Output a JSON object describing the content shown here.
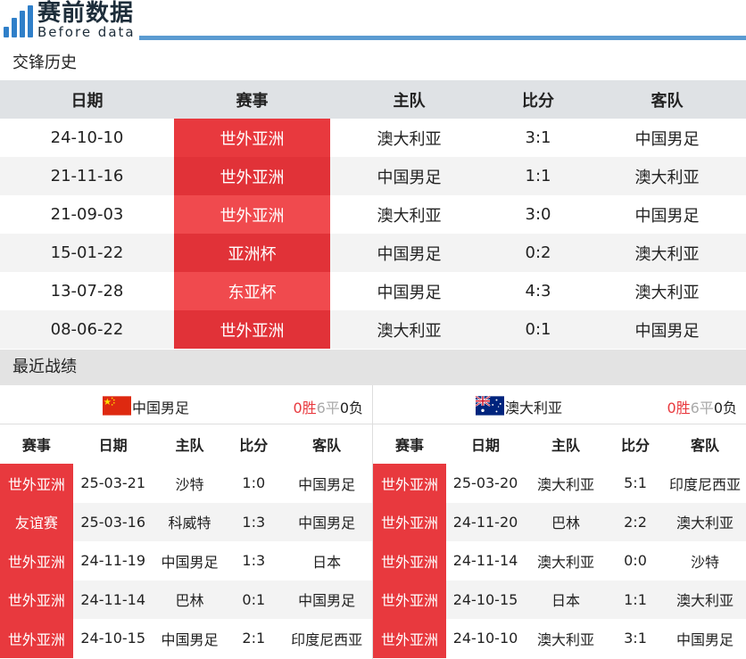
{
  "header": {
    "logo_title": "赛前数据",
    "logo_subtitle": "Before data"
  },
  "h2h": {
    "section_title": "交锋历史",
    "columns": [
      "日期",
      "赛事",
      "主队",
      "比分",
      "客队"
    ],
    "rows": [
      {
        "date": "24-10-10",
        "event": "世外亚洲",
        "home": "澳大利亚",
        "score": "3:1",
        "away": "中国男足"
      },
      {
        "date": "21-11-16",
        "event": "世外亚洲",
        "home": "中国男足",
        "score": "1:1",
        "away": "澳大利亚"
      },
      {
        "date": "21-09-03",
        "event": "世外亚洲",
        "home": "澳大利亚",
        "score": "3:0",
        "away": "中国男足"
      },
      {
        "date": "15-01-22",
        "event": "亚洲杯",
        "home": "中国男足",
        "score": "0:2",
        "away": "澳大利亚"
      },
      {
        "date": "13-07-28",
        "event": "东亚杯",
        "home": "中国男足",
        "score": "4:3",
        "away": "澳大利亚"
      },
      {
        "date": "08-06-22",
        "event": "世外亚洲",
        "home": "澳大利亚",
        "score": "0:1",
        "away": "中国男足"
      }
    ]
  },
  "recent": {
    "section_title": "最近战绩",
    "columns": [
      "赛事",
      "日期",
      "主队",
      "比分",
      "客队"
    ],
    "left": {
      "team": "中国男足",
      "wins": "0胜",
      "draws": "6平",
      "losses": "0负",
      "rows": [
        {
          "event": "世外亚洲",
          "date": "25-03-21",
          "home": "沙特",
          "score": "1:0",
          "away": "中国男足"
        },
        {
          "event": "友谊赛",
          "date": "25-03-16",
          "home": "科威特",
          "score": "1:3",
          "away": "中国男足"
        },
        {
          "event": "世外亚洲",
          "date": "24-11-19",
          "home": "中国男足",
          "score": "1:3",
          "away": "日本"
        },
        {
          "event": "世外亚洲",
          "date": "24-11-14",
          "home": "巴林",
          "score": "0:1",
          "away": "中国男足"
        },
        {
          "event": "世外亚洲",
          "date": "24-10-15",
          "home": "中国男足",
          "score": "2:1",
          "away": "印度尼西亚"
        }
      ]
    },
    "right": {
      "team": "澳大利亚",
      "wins": "0胜",
      "draws": "6平",
      "losses": "0负",
      "rows": [
        {
          "event": "世外亚洲",
          "date": "25-03-20",
          "home": "澳大利亚",
          "score": "5:1",
          "away": "印度尼西亚"
        },
        {
          "event": "世外亚洲",
          "date": "24-11-20",
          "home": "巴林",
          "score": "2:2",
          "away": "澳大利亚"
        },
        {
          "event": "世外亚洲",
          "date": "24-11-14",
          "home": "澳大利亚",
          "score": "0:0",
          "away": "沙特"
        },
        {
          "event": "世外亚洲",
          "date": "24-10-15",
          "home": "日本",
          "score": "1:1",
          "away": "澳大利亚"
        },
        {
          "event": "世外亚洲",
          "date": "24-10-10",
          "home": "澳大利亚",
          "score": "3:1",
          "away": "中国男足"
        }
      ]
    }
  },
  "colors": {
    "accent_red": "#e8393e",
    "header_line_blue": "#5b9bd1",
    "logo_blue": "#2f7fc9"
  }
}
